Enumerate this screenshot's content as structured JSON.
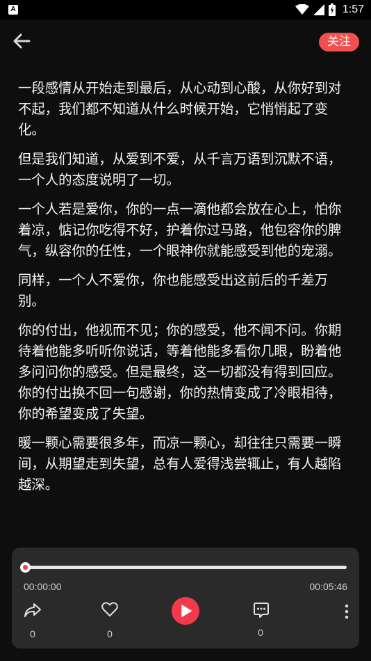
{
  "status_bar": {
    "time": "1:57",
    "app_icon_letter": "A",
    "icons": [
      "wifi-icon",
      "signal-icon",
      "battery-icon"
    ]
  },
  "header": {
    "back_icon": "back-arrow-icon",
    "follow_label": "关注"
  },
  "article": {
    "paragraphs": [
      "一段感情从开始走到最后，从心动到心酸，从你好到对不起，我们都不知道从什么时候开始，它悄悄起了变化。",
      "但是我们知道，从爱到不爱，从千言万语到沉默不语，一个人的态度说明了一切。",
      "一个人若是爱你，你的一点一滴他都会放在心上，怕你着凉，惦记你吃得不好，护着你过马路，他包容你的脾气，纵容你的任性，一个眼神你就能感受到他的宠溺。",
      "同样，一个人不爱你，你也能感受出这前后的千差万别。",
      "你的付出，他视而不见；你的感受，他不闻不问。你期待着他能多听听你说话，等着他能多看你几眼，盼着他多问问你的感受。但是最终，这一切都没有得到回应。你的付出换不回一句感谢，你的热情变成了冷眼相待，你的希望变成了失望。",
      "暖一颗心需要很多年，而凉一颗心，却往往只需要一瞬间，从期望走到失望，总有人爱得浅尝辄止，有人越陷越深。"
    ]
  },
  "player": {
    "current_time": "00:00:00",
    "total_time": "00:05:46",
    "progress": 0.0,
    "share_count": "0",
    "like_count": "0",
    "comment_count": "0",
    "accent_color": "#f23a4a"
  }
}
